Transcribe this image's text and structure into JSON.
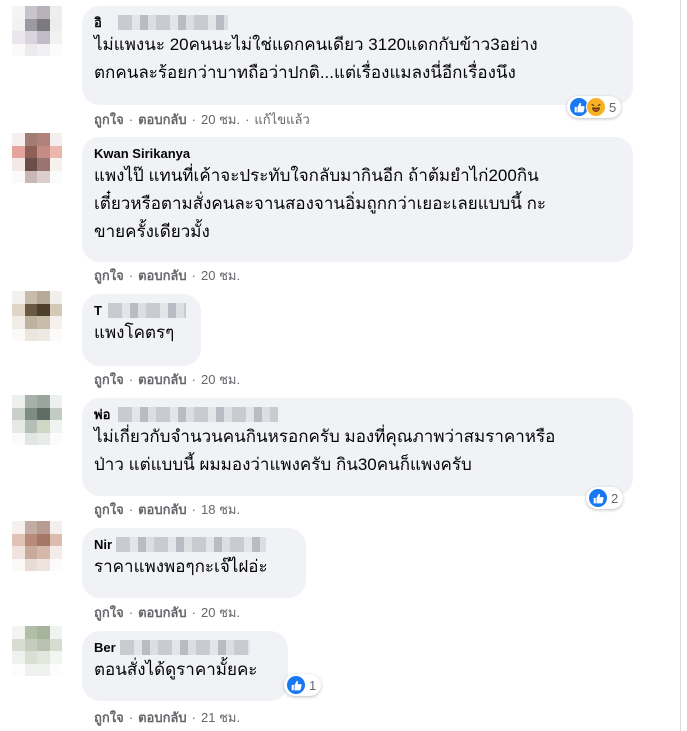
{
  "colors": {
    "bubble": "#f0f2f5",
    "like_blue": "#1877f2",
    "meta_gray": "#65676b",
    "haha_yellow": "#f7b125"
  },
  "comments": [
    {
      "author_visible": "อิ",
      "lines": [
        "ไม่แพงนะ 20คนนะไม่ใช่แดกคนเดียว 3120แดกกับข้าว3อย่าง",
        "ตกคนละร้อยกว่าบาทถือว่าปกติ...แต่เรื่องแมลงนี่อีกเรื่องนึง"
      ],
      "like": "ถูกใจ",
      "reply": "ตอบกลับ",
      "time": "20 ชม.",
      "edited": "แก้ไขแล้ว",
      "reactions": {
        "icons": [
          "like-icon",
          "haha-icon"
        ],
        "count": "5"
      }
    },
    {
      "author_visible": "Kwan Sirikanya",
      "lines": [
        "แพงไป๊ แทนที่เค้าจะประทับใจกลับมากินอีก ถ้าต้มยำไก่200กิน",
        "เตี๋ยวหรือตามสั่งคนละจานสองจานอิ่มถูกกว่าเยอะเลยแบบนี้ กะ",
        "ขายครั้งเดียวมั้ง"
      ],
      "like": "ถูกใจ",
      "reply": "ตอบกลับ",
      "time": "20 ชม."
    },
    {
      "author_visible": "T",
      "lines": [
        "แพงโคตรๆ"
      ],
      "like": "ถูกใจ",
      "reply": "ตอบกลับ",
      "time": "20 ชม."
    },
    {
      "author_visible": "พ่อ",
      "lines": [
        "ไม่เกี่ยวกับจำนวนคนกินหรอกครับ มองที่คุณภาพว่าสมราคาหรือ",
        "ป่าว แต่แบบนี้ ผมมองว่าแพงครับ กิน30คนก็แพงครับ"
      ],
      "like": "ถูกใจ",
      "reply": "ตอบกลับ",
      "time": "18 ชม.",
      "reactions": {
        "icons": [
          "like-icon"
        ],
        "count": "2"
      }
    },
    {
      "author_visible": "Nir",
      "lines": [
        "ราคาแพงพอๆกะเจ๊ไฝอ่ะ"
      ],
      "like": "ถูกใจ",
      "reply": "ตอบกลับ",
      "time": "20 ชม."
    },
    {
      "author_visible": "Ber",
      "lines": [
        "ตอนสั่งได้ดูราคามั้ยคะ"
      ],
      "like": "ถูกใจ",
      "reply": "ตอบกลับ",
      "time": "21 ชม.",
      "reactions": {
        "icons": [
          "like-icon"
        ],
        "count": "1"
      }
    }
  ]
}
